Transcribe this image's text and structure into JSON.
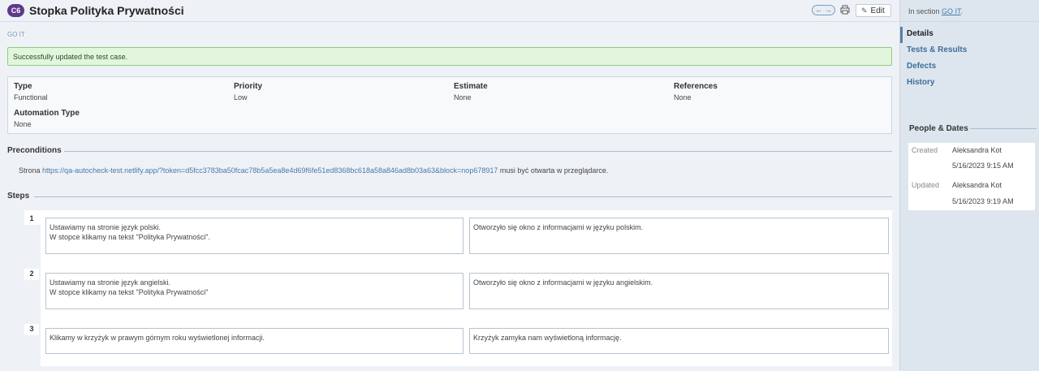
{
  "header": {
    "case_id": "C6",
    "title": "Stopka Polityka Prywatności",
    "edit_label": "Edit",
    "nav_arrows": "← →"
  },
  "breadcrumb": "GO IT",
  "alert": "Successfully updated the test case.",
  "fields": {
    "type": {
      "label": "Type",
      "value": "Functional"
    },
    "priority": {
      "label": "Priority",
      "value": "Low"
    },
    "estimate": {
      "label": "Estimate",
      "value": "None"
    },
    "references": {
      "label": "References",
      "value": "None"
    },
    "automation_type": {
      "label": "Automation Type",
      "value": "None"
    }
  },
  "preconditions": {
    "heading": "Preconditions",
    "prefix": "Strona",
    "link": "https://qa-autocheck-test.netlify.app/?token=d5fcc3783ba50fcac78b5a5ea8e4d69f6fe51ed8368bc618a58a846ad8b03a63&block=nop678917",
    "suffix": "musi być otwarta w przeglądarce."
  },
  "steps": {
    "heading": "Steps",
    "items": [
      {
        "num": "1",
        "action_l1": "Ustawiamy na stronie język polski.",
        "action_l2": "W stopce klikamy na tekst \"Polityka Prywatności\".",
        "expected": "Otworzyło się okno z informacjami w języku polskim."
      },
      {
        "num": "2",
        "action_l1": "Ustawiamy na stronie język angielski.",
        "action_l2": "W stopce klikamy na tekst \"Polityka Prywatności\"",
        "expected": "Otworzyło się okno z informacjami w języku angielskim."
      },
      {
        "num": "3",
        "action_l1": "Klikamy w krzyżyk w prawym górnym roku wyświetlonej informacji.",
        "action_l2": "",
        "expected": "Krzyżyk zamyka nam wyświetloną informację."
      }
    ]
  },
  "sidebar": {
    "section_prefix": "In section",
    "section_link": "GO IT",
    "section_suffix": ".",
    "nav": [
      "Details",
      "Tests & Results",
      "Defects",
      "History"
    ],
    "people_heading": "People & Dates",
    "created_label": "Created",
    "created_by": "Aleksandra Kot",
    "created_date": "5/16/2023 9:15 AM",
    "updated_label": "Updated",
    "updated_by": "Aleksandra Kot",
    "updated_date": "5/16/2023 9:19 AM"
  },
  "colors": {
    "badge": "#5d3a8a",
    "link": "#4b79a8",
    "success_bg": "#e2f6dd",
    "success_border": "#8fcc82"
  }
}
